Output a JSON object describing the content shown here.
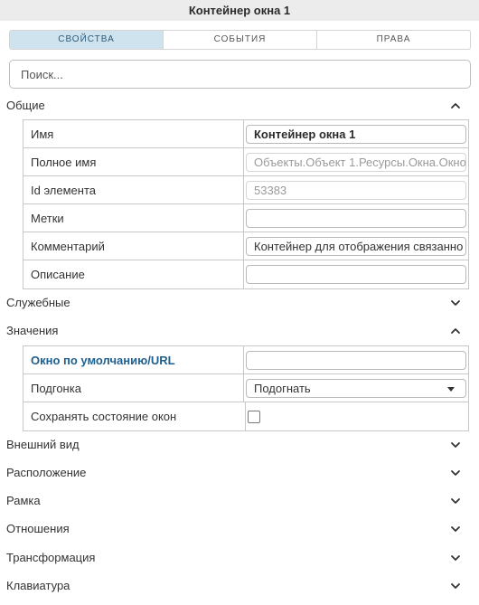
{
  "title": "Контейнер окна 1",
  "tabs": [
    {
      "label": "СВОЙСТВА",
      "active": true
    },
    {
      "label": "СОБЫТИЯ",
      "active": false
    },
    {
      "label": "ПРАВА",
      "active": false
    }
  ],
  "search": {
    "placeholder": "Поиск..."
  },
  "sections": {
    "general": {
      "label": "Общие",
      "expanded": true,
      "rows": {
        "name": {
          "label": "Имя",
          "value": "Контейнер окна 1"
        },
        "full_name": {
          "label": "Полное имя",
          "value": "Объекты.Объект 1.Ресурсы.Окна.Окно"
        },
        "element_id": {
          "label": "Id элемента",
          "value": "53383"
        },
        "tags": {
          "label": "Метки",
          "value": ""
        },
        "comment": {
          "label": "Комментарий",
          "value": "Контейнер для отображения связанно"
        },
        "description": {
          "label": "Описание",
          "value": ""
        }
      }
    },
    "service": {
      "label": "Служебные",
      "expanded": false
    },
    "values": {
      "label": "Значения",
      "expanded": true,
      "rows": {
        "default_window": {
          "label": "Окно по умолчанию/URL",
          "value": ""
        },
        "fit": {
          "label": "Подгонка",
          "value": "Подогнать"
        },
        "save_state": {
          "label": "Сохранять состояние окон",
          "checked": false
        }
      }
    },
    "appearance": {
      "label": "Внешний вид",
      "expanded": false
    },
    "layout": {
      "label": "Расположение",
      "expanded": false
    },
    "frame": {
      "label": "Рамка",
      "expanded": false
    },
    "relations": {
      "label": "Отношения",
      "expanded": false
    },
    "transform": {
      "label": "Трансформация",
      "expanded": false
    },
    "keyboard": {
      "label": "Клавиатура",
      "expanded": false
    }
  },
  "icons": {
    "expanded": "chevron-up-icon",
    "collapsed": "chevron-down-icon"
  },
  "colors": {
    "active_tab_bg": "#cfe3ef",
    "link_label": "#1f5f8f",
    "title_bar_bg": "#ececec"
  }
}
